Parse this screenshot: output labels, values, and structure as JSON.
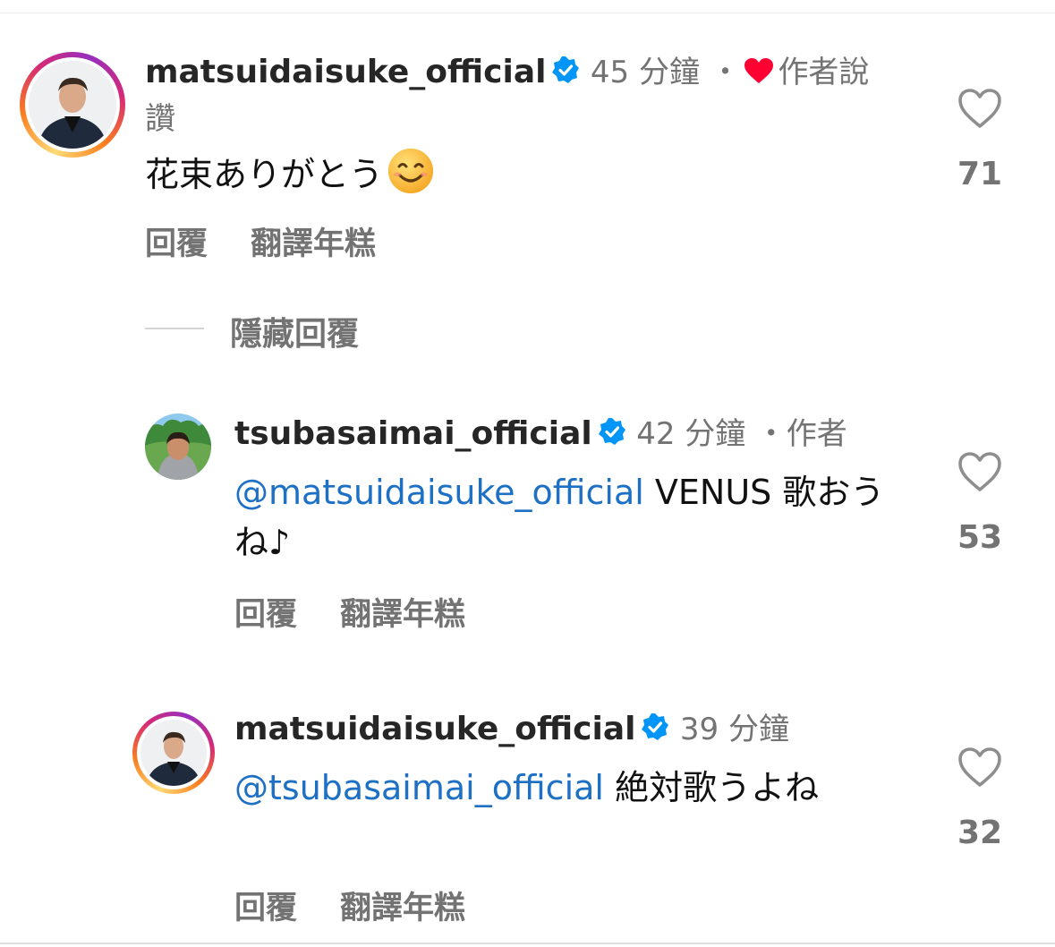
{
  "comments": [
    {
      "username": "matsuidaisuke_official",
      "verified": true,
      "time": "45 分鐘",
      "separator": "・",
      "author_liked_label": "作者說讚",
      "mention": "",
      "text": "花束ありがとう",
      "emoji": "smiling-face-emoji",
      "reply_label": "回覆",
      "translate_label": "翻譯年糕",
      "like_count": "71"
    },
    {
      "username": "tsubasaimai_official",
      "verified": true,
      "time": "42 分鐘",
      "separator": "・",
      "author_label": "作者",
      "mention": "@matsuidaisuke_official",
      "text": " VENUS 歌おうね♪",
      "reply_label": "回覆",
      "translate_label": "翻譯年糕",
      "like_count": "53"
    },
    {
      "username": "matsuidaisuke_official",
      "verified": true,
      "time": "39 分鐘",
      "mention": "@tsubasaimai_official",
      "text": " 絶対歌うよね",
      "reply_label": "回覆",
      "translate_label": "翻譯年糕",
      "like_count": "32"
    }
  ],
  "hide_replies_label": "隱藏回覆",
  "colors": {
    "mention": "#1d70c4",
    "verified": "#0095f6",
    "author_heart": "#ff0033",
    "muted": "#737373"
  }
}
